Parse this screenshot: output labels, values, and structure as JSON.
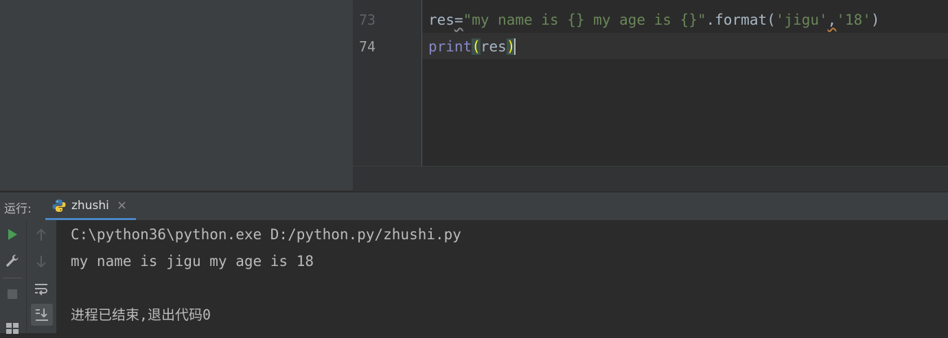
{
  "editor": {
    "lines": [
      {
        "number": "73",
        "tokens": {
          "t1": "res",
          "t2": "=",
          "t3": "\"my name is {} my age is {}\"",
          "t4": ".format(",
          "t5": "'jigu'",
          "t6": ",",
          "t7": "'18'",
          "t8": ")"
        }
      },
      {
        "number": "74",
        "tokens": {
          "t1": "print",
          "t2": "(",
          "t3": "res",
          "t4": ")"
        }
      }
    ]
  },
  "run_window": {
    "label": "运行:",
    "tab": {
      "label": "zhushi",
      "close": "×"
    },
    "console": [
      "C:\\python36\\python.exe D:/python.py/zhushi.py",
      "my name is jigu my age is 18",
      "",
      "进程已结束,退出代码0"
    ]
  },
  "icons": {
    "run": "play-icon",
    "tool": "wrench-icon",
    "stop": "stop-icon",
    "layout": "layout-icon",
    "up": "arrow-up-icon",
    "down": "arrow-down-icon",
    "wrap": "soft-wrap-icon",
    "scroll_end": "scroll-to-end-icon",
    "python": "python-icon"
  },
  "colors": {
    "run_green": "#499c54",
    "string": "#6a8759",
    "builtin": "#8888c6",
    "bracket_highlight": "#ffef28",
    "tab_underline": "#4a88c7"
  }
}
